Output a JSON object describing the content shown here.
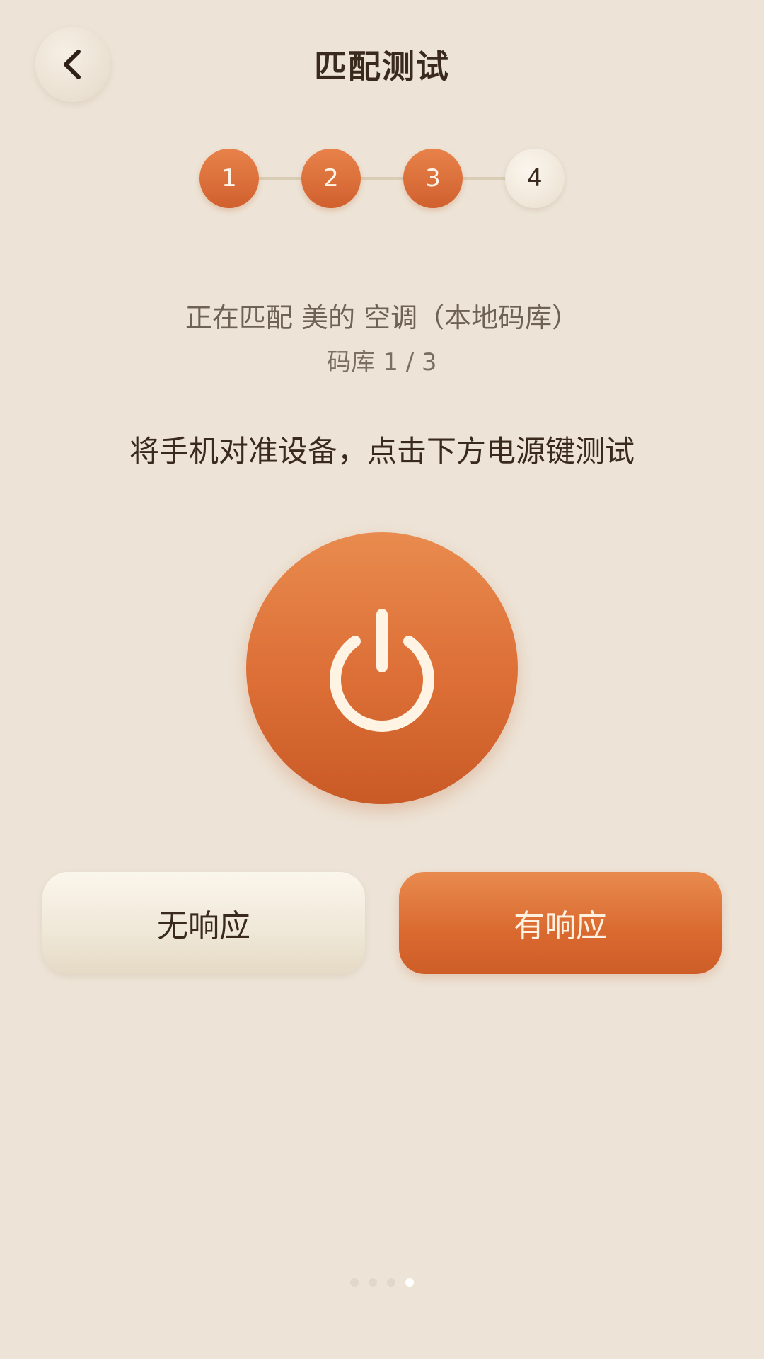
{
  "header": {
    "title": "匹配测试",
    "back_icon": "chevron-left-icon"
  },
  "stepper": {
    "steps": [
      {
        "label": "1",
        "state": "done"
      },
      {
        "label": "2",
        "state": "done"
      },
      {
        "label": "3",
        "state": "done"
      },
      {
        "label": "4",
        "state": "current"
      }
    ],
    "current_step": 4
  },
  "status": {
    "matching_text": "正在匹配 美的 空调（本地码库）",
    "library_text": "码库 1 / 3"
  },
  "instruction": "将手机对准设备，点击下方电源键测试",
  "power_button": {
    "icon": "power-icon"
  },
  "actions": {
    "no_response_label": "无响应",
    "has_response_label": "有响应"
  },
  "pager": {
    "count": 4,
    "active_index": 3
  },
  "colors": {
    "background": "#EDE4D7",
    "accent": "#DC6E36",
    "accent_light": "#E98B4E",
    "text_primary": "#3A2A1E",
    "text_secondary": "#6E6156"
  }
}
